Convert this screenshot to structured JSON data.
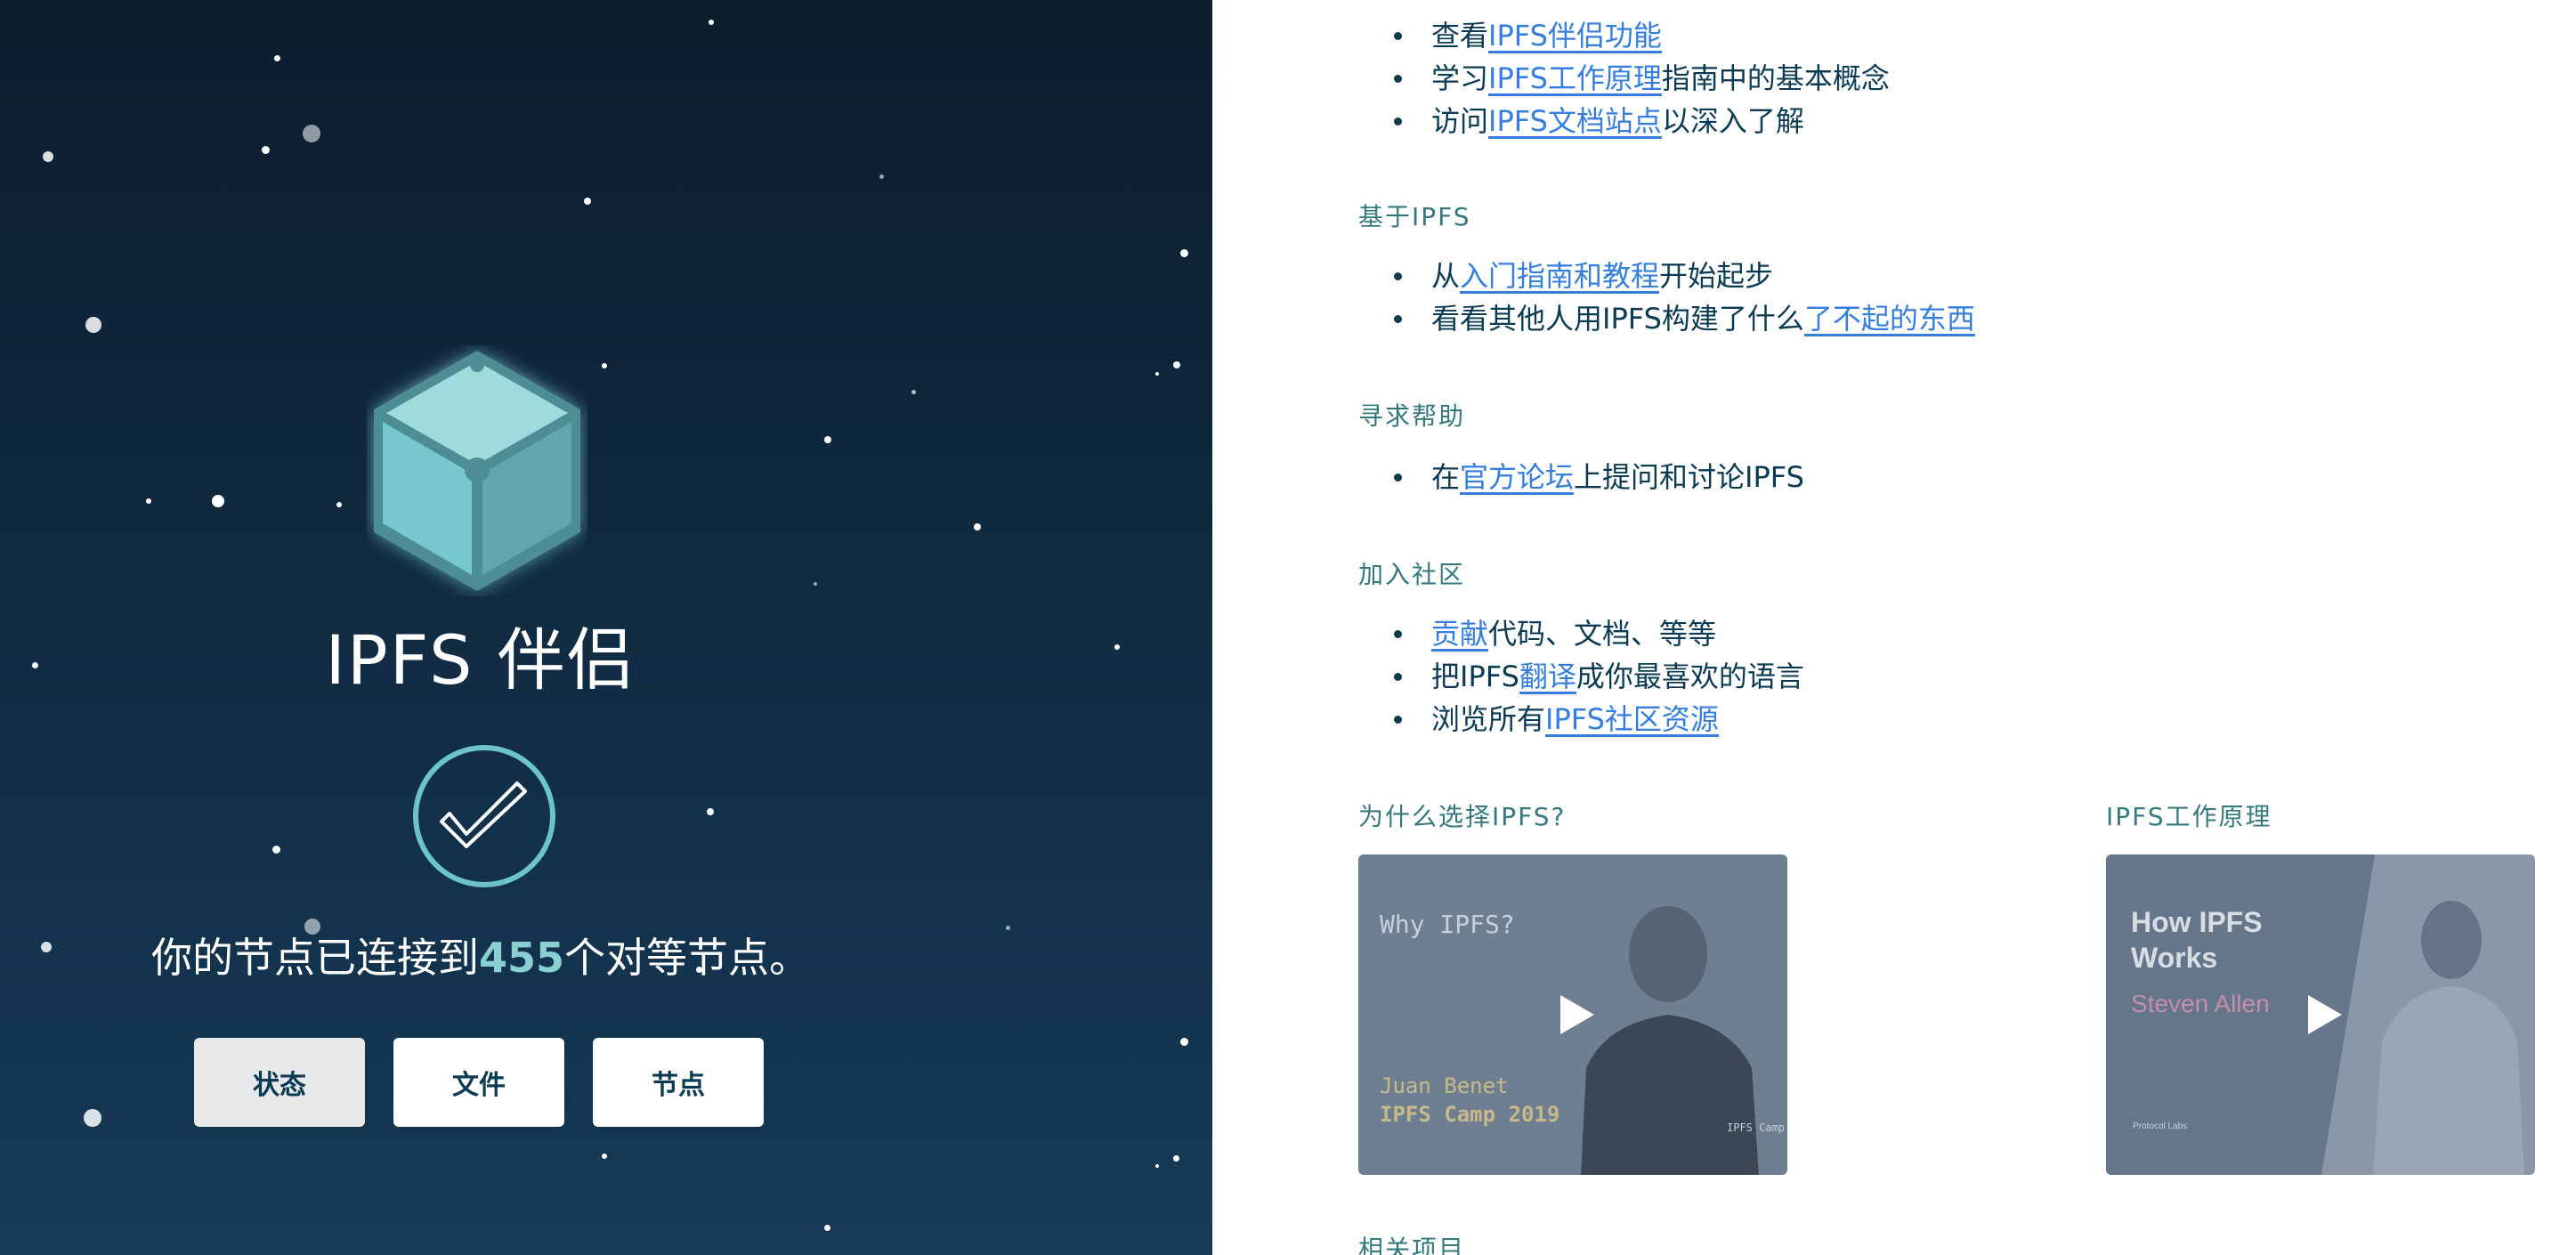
{
  "left": {
    "app_title": "IPFS 伴侣",
    "status": {
      "prefix": "你的节点已连接到",
      "peer_count": "455",
      "suffix": "个对等节点。"
    },
    "buttons": {
      "status": "状态",
      "files": "文件",
      "peers": "节点"
    },
    "icons": {
      "logo": "ipfs-cube-icon",
      "connected": "checkmark-circle-icon"
    }
  },
  "right": {
    "top_items": [
      {
        "pre": "查看",
        "link": "IPFS伴侣功能",
        "post": ""
      },
      {
        "pre": "学习",
        "link": "IPFS工作原理",
        "post": "指南中的基本概念"
      },
      {
        "pre": "访问",
        "link": "IPFS文档站点",
        "post": "以深入了解"
      }
    ],
    "sections": [
      {
        "title": "基于IPFS",
        "items": [
          {
            "pre": "从",
            "link": "入门指南和教程",
            "post": "开始起步"
          },
          {
            "pre": "看看其他人用IPFS构建了什么",
            "link": "了不起的东西",
            "post": ""
          }
        ]
      },
      {
        "title": "寻求帮助",
        "items": [
          {
            "pre": "在",
            "link": "官方论坛",
            "post": "上提问和讨论IPFS"
          }
        ]
      },
      {
        "title": "加入社区",
        "items": [
          {
            "pre": "",
            "link": "贡献",
            "post": "代码、文档、等等"
          },
          {
            "pre": "把IPFS",
            "link": "翻译",
            "post": "成你最喜欢的语言"
          },
          {
            "pre": "浏览所有",
            "link": "IPFS社区资源",
            "post": ""
          }
        ]
      }
    ],
    "videos": [
      {
        "title": "为什么选择IPFS?",
        "thumb_heading": "Why IPFS?",
        "thumb_name": "Juan Benet",
        "thumb_event": "IPFS Camp 2019",
        "thumb_shirt": "IPFS Camp"
      },
      {
        "title": "IPFS工作原理",
        "thumb_heading_1": "How IPFS",
        "thumb_heading_2": "Works",
        "thumb_name": "Steven Allen",
        "thumb_brand": "Protocol Labs"
      }
    ],
    "related_title": "相关项目"
  },
  "colors": {
    "accent": "#357edd",
    "teal": "#34797d",
    "navy": "#0b3a53",
    "peer_count": "#8ad0d2"
  }
}
